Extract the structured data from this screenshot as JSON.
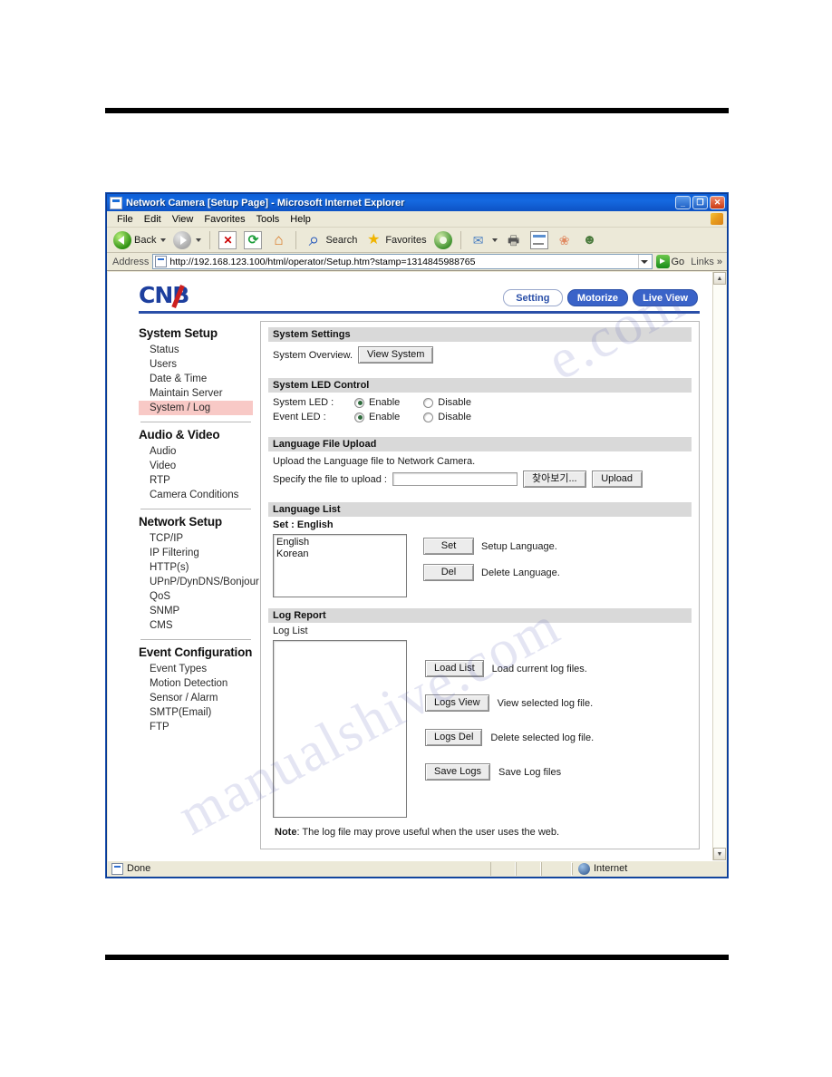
{
  "browser": {
    "title": "Network Camera [Setup Page] - Microsoft Internet Explorer",
    "window_buttons": {
      "minimize": "_",
      "maximize": "❐",
      "close": "✕"
    },
    "menus": [
      "File",
      "Edit",
      "View",
      "Favorites",
      "Tools",
      "Help"
    ],
    "toolbar": [
      {
        "name": "back",
        "label": "Back",
        "icon": "back-arrow-icon"
      },
      {
        "name": "forward",
        "label": "",
        "icon": "forward-arrow-icon"
      },
      {
        "name": "stop",
        "label": "",
        "icon": "stop-icon"
      },
      {
        "name": "refresh",
        "label": "",
        "icon": "refresh-icon"
      },
      {
        "name": "home",
        "label": "",
        "icon": "home-icon"
      },
      {
        "name": "search",
        "label": "Search",
        "icon": "search-icon"
      },
      {
        "name": "favorites",
        "label": "Favorites",
        "icon": "star-icon"
      },
      {
        "name": "media",
        "label": "",
        "icon": "media-globe-icon"
      },
      {
        "name": "mail",
        "label": "",
        "icon": "mail-icon"
      },
      {
        "name": "print",
        "label": "",
        "icon": "printer-icon"
      },
      {
        "name": "edit",
        "label": "",
        "icon": "edit-page-icon"
      },
      {
        "name": "messenger",
        "label": "",
        "icon": "messenger-icon"
      },
      {
        "name": "discuss",
        "label": "",
        "icon": "discuss-icon"
      }
    ],
    "address": {
      "label": "Address",
      "url": "http://192.168.123.100/html/operator/Setup.htm?stamp=1314845988765",
      "go_label": "Go",
      "links_label": "Links",
      "overflow_chevron": "»"
    },
    "status": {
      "text": "Done",
      "zone": "Internet"
    }
  },
  "header": {
    "logo": "CNB",
    "nav": [
      {
        "label": "Setting",
        "state": "active"
      },
      {
        "label": "Motorize",
        "state": "blue"
      },
      {
        "label": "Live View",
        "state": "blue"
      }
    ]
  },
  "sidebar": {
    "groups": [
      {
        "title": "System Setup",
        "items": [
          {
            "label": "Status",
            "selected": false
          },
          {
            "label": "Users",
            "selected": false
          },
          {
            "label": "Date & Time",
            "selected": false
          },
          {
            "label": "Maintain Server",
            "selected": false
          },
          {
            "label": "System / Log",
            "selected": true
          }
        ]
      },
      {
        "title": "Audio & Video",
        "items": [
          {
            "label": "Audio",
            "selected": false
          },
          {
            "label": "Video",
            "selected": false
          },
          {
            "label": "RTP",
            "selected": false
          },
          {
            "label": "Camera Conditions",
            "selected": false
          }
        ]
      },
      {
        "title": "Network Setup",
        "items": [
          {
            "label": "TCP/IP",
            "selected": false
          },
          {
            "label": "IP Filtering",
            "selected": false
          },
          {
            "label": "HTTP(s)",
            "selected": false
          },
          {
            "label": "UPnP/DynDNS/Bonjour",
            "selected": false
          },
          {
            "label": "QoS",
            "selected": false
          },
          {
            "label": "SNMP",
            "selected": false
          },
          {
            "label": "CMS",
            "selected": false
          }
        ]
      },
      {
        "title": "Event Configuration",
        "items": [
          {
            "label": "Event Types",
            "selected": false
          },
          {
            "label": "Motion Detection",
            "selected": false
          },
          {
            "label": "Sensor / Alarm",
            "selected": false
          },
          {
            "label": "SMTP(Email)",
            "selected": false
          },
          {
            "label": "FTP",
            "selected": false
          }
        ]
      }
    ]
  },
  "main": {
    "system_settings": {
      "heading": "System Settings",
      "overview_label": "System Overview.",
      "view_system_button": "View System"
    },
    "system_led_control": {
      "heading": "System LED Control",
      "rows": [
        {
          "label": "System LED :",
          "options": [
            {
              "label": "Enable",
              "selected": true
            },
            {
              "label": "Disable",
              "selected": false
            }
          ]
        },
        {
          "label": "Event LED :",
          "options": [
            {
              "label": "Enable",
              "selected": true
            },
            {
              "label": "Disable",
              "selected": false
            }
          ]
        }
      ]
    },
    "language_file_upload": {
      "heading": "Language File Upload",
      "description": "Upload the Language file to Network Camera.",
      "field_label": "Specify the file to upload :",
      "file_value": "",
      "browse_button": "찾아보기...",
      "upload_button": "Upload"
    },
    "language_list": {
      "heading": "Language List",
      "current_label": "Set : English",
      "items": [
        "English",
        "Korean"
      ],
      "actions": [
        {
          "button": "Set",
          "description": "Setup Language."
        },
        {
          "button": "Del",
          "description": "Delete Language."
        }
      ]
    },
    "log_report": {
      "heading": "Log Report",
      "list_label": "Log List",
      "log_items": [],
      "actions": [
        {
          "button": "Load List",
          "description": "Load current log files."
        },
        {
          "button": "Logs View",
          "description": "View selected log file."
        },
        {
          "button": "Logs Del",
          "description": "Delete selected log file."
        },
        {
          "button": "Save Logs",
          "description": "Save Log files"
        }
      ],
      "note_prefix": "Note",
      "note_text": ": The log file may prove useful when the user uses the web."
    }
  },
  "watermark": {
    "line1": "manualshive.com",
    "line2": "e.com"
  }
}
